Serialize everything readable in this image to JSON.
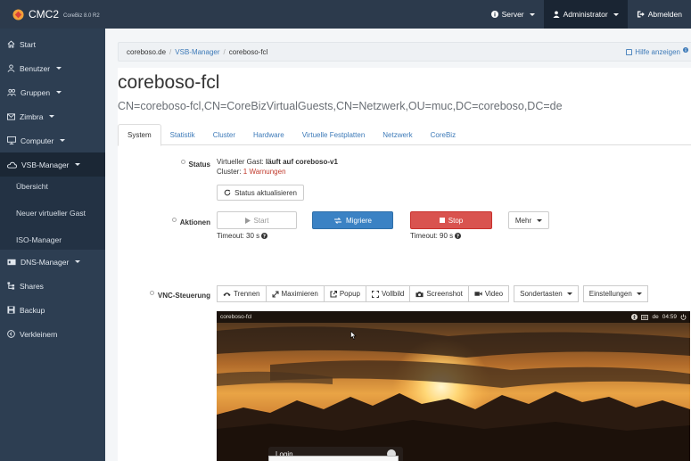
{
  "topbar": {
    "brand": "CMC2",
    "version": "CoreBiz 8.0 R2",
    "server": "Server",
    "user": "Administrator",
    "logout": "Abmelden"
  },
  "sidebar": {
    "items": [
      {
        "label": "Start"
      },
      {
        "label": "Benutzer"
      },
      {
        "label": "Gruppen"
      },
      {
        "label": "Zimbra"
      },
      {
        "label": "Computer"
      },
      {
        "label": "VSB-Manager"
      },
      {
        "label": "DNS-Manager"
      },
      {
        "label": "Shares"
      },
      {
        "label": "Backup"
      },
      {
        "label": "Verkleinern"
      }
    ],
    "sub": [
      "Übersicht",
      "Neuer virtueller Gast",
      "ISO-Manager"
    ]
  },
  "breadcrumb": {
    "home": "coreboso.de",
    "section": "VSB-Manager",
    "current": "coreboso-fcl",
    "help": "Hilfe anzeigen"
  },
  "page": {
    "title": "coreboso-fcl",
    "dn": "CN=coreboso-fcl,CN=CoreBizVirtualGuests,CN=Netzwerk,OU=muc,DC=coreboso,DC=de"
  },
  "tabs": [
    "System",
    "Statistik",
    "Cluster",
    "Hardware",
    "Virtuelle Festplatten",
    "Netzwerk",
    "CoreBiz"
  ],
  "status": {
    "label": "Status",
    "line1_prefix": "Virtueller Gast:",
    "line1_value": "läuft auf coreboso-v1",
    "line2_prefix": "Cluster:",
    "line2_value": "1 Warnungen",
    "refresh_button": "Status aktualisieren"
  },
  "actions": {
    "label": "Aktionen",
    "start": "Start",
    "migrate": "Migriere",
    "stop": "Stop",
    "more": "Mehr",
    "timeout_start": "Timeout: 30 s",
    "timeout_stop": "Timeout: 90 s"
  },
  "vnc": {
    "label": "VNC-Steuerung",
    "buttons": [
      "Trennen",
      "Maximieren",
      "Popup",
      "Vollbild",
      "Screenshot",
      "Video"
    ],
    "special_keys": "Sondertasten",
    "settings": "Einstellungen",
    "guest_name": "coreboso-fcl",
    "locale": "de",
    "time": "04:59",
    "login_title": "Login"
  },
  "colors": {
    "topbar": "#2c3a4c",
    "sidebar": "#2d3e52",
    "link": "#3d7ab8",
    "primary": "#3b82c4",
    "danger": "#d9534f"
  }
}
